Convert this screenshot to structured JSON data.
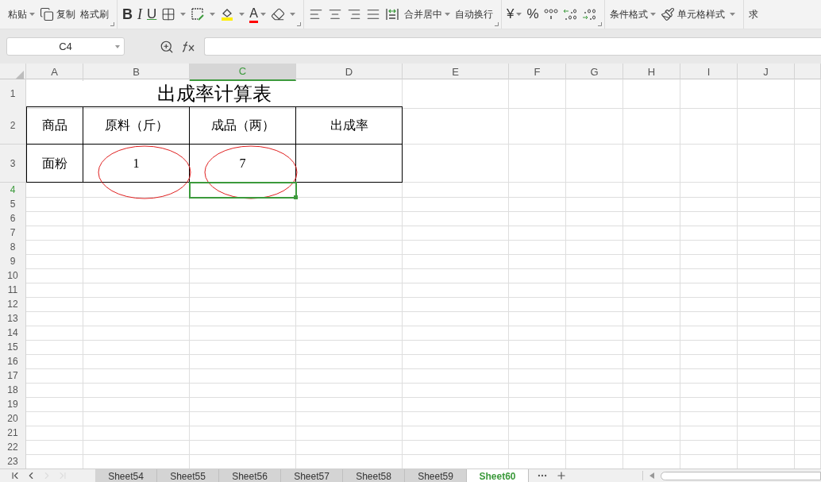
{
  "toolbar": {
    "groups": [
      {
        "corner": true,
        "items": [
          {
            "kind": "text",
            "label": "粘贴",
            "dropdown": true
          },
          {
            "kind": "icon",
            "label": "复制",
            "dropdown": false
          },
          {
            "kind": "text",
            "label": "格式刷",
            "dropdown": false
          }
        ]
      },
      {
        "corner": true,
        "items": [
          {
            "kind": "bold",
            "label": "B"
          },
          {
            "kind": "italic",
            "label": "I"
          },
          {
            "kind": "underline",
            "label": "U"
          },
          {
            "kind": "icon",
            "dropdown": true
          },
          {
            "kind": "icon",
            "dropdown": true
          },
          {
            "kind": "icon",
            "dropdown": true
          },
          {
            "kind": "fontcolor",
            "label": "A",
            "dropdown": true
          },
          {
            "kind": "icon",
            "dropdown": true
          }
        ]
      },
      {
        "corner": true,
        "items": [
          {
            "kind": "icon",
            "dropdown": false
          },
          {
            "kind": "icon",
            "dropdown": false
          },
          {
            "kind": "icon",
            "dropdown": false
          },
          {
            "kind": "icon",
            "dropdown": false
          },
          {
            "kind": "icon",
            "dropdown": false
          },
          {
            "kind": "text",
            "label": "合并居中",
            "dropdown": true
          },
          {
            "kind": "text",
            "label": "自动换行",
            "dropdown": false
          }
        ]
      },
      {
        "corner": true,
        "items": [
          {
            "kind": "symbol",
            "label": "¥",
            "dropdown": true
          },
          {
            "kind": "symbol",
            "label": "%",
            "dropdown": false
          },
          {
            "kind": "icon",
            "dropdown": false
          },
          {
            "kind": "icon",
            "dropdown": false
          },
          {
            "kind": "icon",
            "dropdown": false
          }
        ]
      },
      {
        "corner": false,
        "items": [
          {
            "kind": "text",
            "label": "条件格式",
            "dropdown": true
          },
          {
            "kind": "icon",
            "label": "单元格样式",
            "dropdown": true
          }
        ]
      },
      {
        "corner": false,
        "items": [
          {
            "kind": "text",
            "label": "求",
            "dropdown": false
          }
        ]
      }
    ]
  },
  "formula_bar": {
    "name_box": "C4"
  },
  "sheet": {
    "columns": [
      {
        "label": "A",
        "selected": false
      },
      {
        "label": "B",
        "selected": false
      },
      {
        "label": "C",
        "selected": true
      },
      {
        "label": "D",
        "selected": false
      },
      {
        "label": "E",
        "selected": false
      },
      {
        "label": "F",
        "selected": false
      },
      {
        "label": "G",
        "selected": false
      },
      {
        "label": "H",
        "selected": false
      },
      {
        "label": "I",
        "selected": false
      },
      {
        "label": "J",
        "selected": false
      }
    ],
    "rows": [
      {
        "label": "1",
        "kind": "title",
        "selected": false,
        "title": "出成率计算表"
      },
      {
        "label": "2",
        "kind": "table",
        "selected": false,
        "cells": [
          {
            "text": "商品",
            "circled": false
          },
          {
            "text": "原料（斤）",
            "circled": false
          },
          {
            "text": "成品（两）",
            "circled": false
          },
          {
            "text": "出成率",
            "circled": false
          }
        ]
      },
      {
        "label": "3",
        "kind": "table",
        "selected": false,
        "cells": [
          {
            "text": "面粉",
            "circled": false
          },
          {
            "text": "1",
            "circled": true
          },
          {
            "text": "7",
            "circled": true
          },
          {
            "circled": false
          }
        ]
      },
      {
        "label": "4",
        "kind": "empty",
        "selected": true
      },
      {
        "label": "5",
        "kind": "empty",
        "selected": false
      },
      {
        "label": "6",
        "kind": "empty",
        "selected": false
      },
      {
        "label": "7",
        "kind": "empty",
        "selected": false
      },
      {
        "label": "8",
        "kind": "empty",
        "selected": false
      },
      {
        "label": "9",
        "kind": "empty",
        "selected": false
      },
      {
        "label": "10",
        "kind": "empty",
        "selected": false
      },
      {
        "label": "11",
        "kind": "empty",
        "selected": false
      },
      {
        "label": "12",
        "kind": "empty",
        "selected": false
      },
      {
        "label": "13",
        "kind": "empty",
        "selected": false
      },
      {
        "label": "14",
        "kind": "empty",
        "selected": false
      },
      {
        "label": "15",
        "kind": "empty",
        "selected": false
      },
      {
        "label": "16",
        "kind": "empty",
        "selected": false
      },
      {
        "label": "17",
        "kind": "empty",
        "selected": false
      },
      {
        "label": "18",
        "kind": "empty",
        "selected": false
      },
      {
        "label": "19",
        "kind": "empty",
        "selected": false
      },
      {
        "label": "20",
        "kind": "empty",
        "selected": false
      },
      {
        "label": "21",
        "kind": "empty",
        "selected": false
      },
      {
        "label": "22",
        "kind": "empty",
        "selected": false
      },
      {
        "label": "23",
        "kind": "empty",
        "selected": false
      }
    ]
  },
  "sheet_tabs": [
    {
      "label": "Sheet54",
      "selected": false
    },
    {
      "label": "Sheet55",
      "selected": false
    },
    {
      "label": "Sheet56",
      "selected": false
    },
    {
      "label": "Sheet57",
      "selected": false
    },
    {
      "label": "Sheet58",
      "selected": false
    },
    {
      "label": "Sheet59",
      "selected": false
    },
    {
      "label": "Sheet60",
      "selected": true
    }
  ]
}
